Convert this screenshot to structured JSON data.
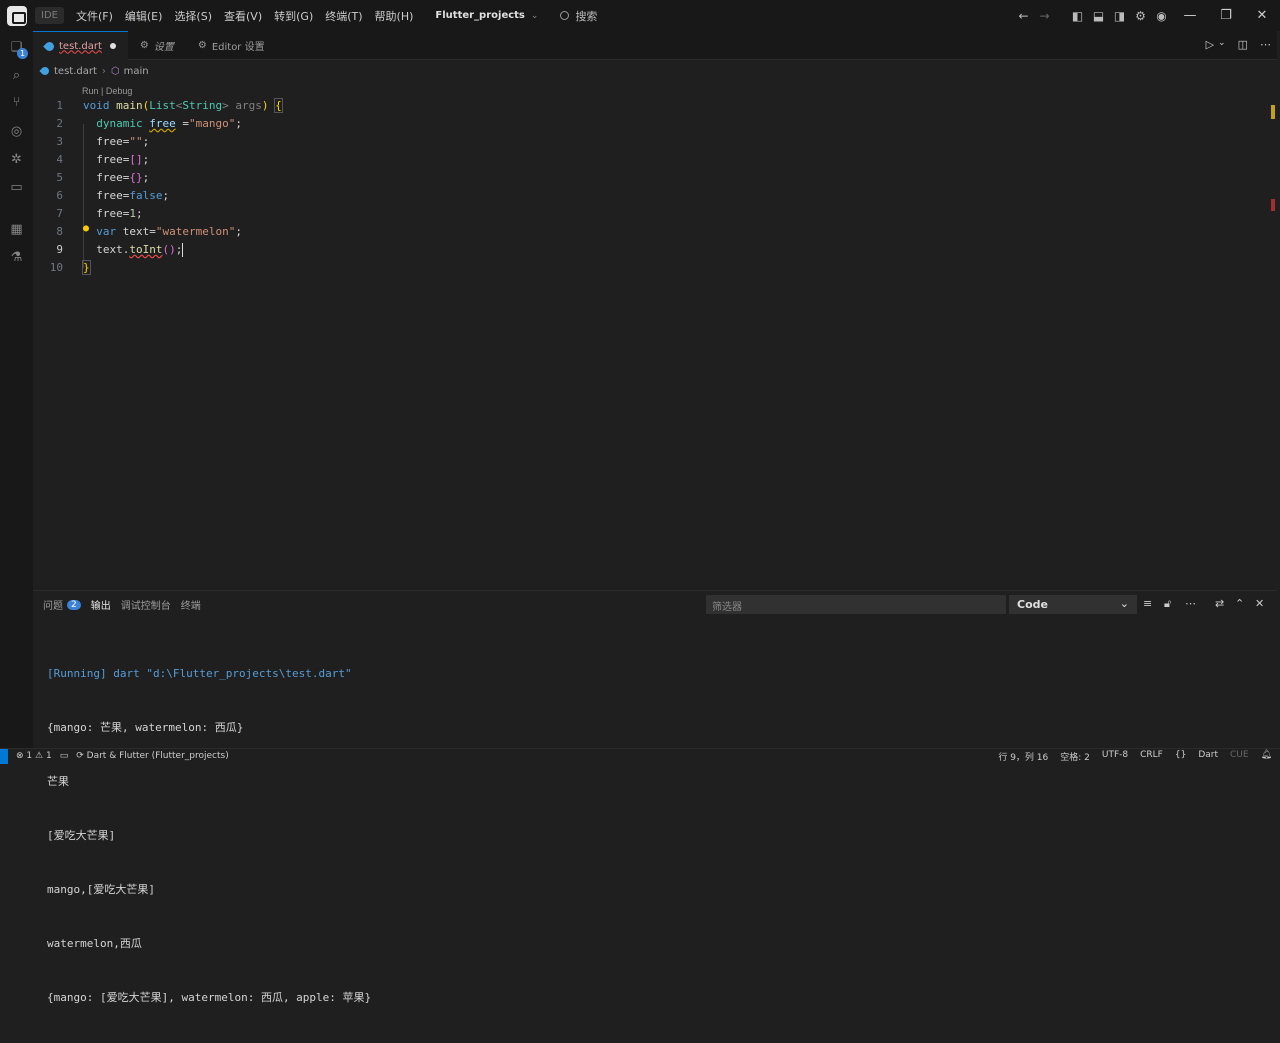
{
  "titlebar": {
    "ide_label": "IDE",
    "menus": [
      "文件(F)",
      "编辑(E)",
      "选择(S)",
      "查看(V)",
      "转到(G)",
      "终端(T)",
      "帮助(H)"
    ],
    "project": "Flutter_projects",
    "search": "搜索"
  },
  "activity": {
    "explorer_badge": "1"
  },
  "tabs": [
    {
      "label": "test.dart",
      "modified": true,
      "active": true
    },
    {
      "label": "设置"
    },
    {
      "label": "Editor 设置"
    }
  ],
  "breadcrumb": {
    "file": "test.dart",
    "symbol": "main"
  },
  "editor": {
    "codelens": "Run | Debug",
    "line_numbers": [
      "1",
      "2",
      "3",
      "4",
      "5",
      "6",
      "7",
      "8",
      "9",
      "10"
    ],
    "current_line": 9
  },
  "panel": {
    "tabs": [
      {
        "label": "问题",
        "count": "2"
      },
      {
        "label": "输出",
        "active": true
      },
      {
        "label": "调试控制台"
      },
      {
        "label": "终端"
      }
    ],
    "filter_placeholder": "筛选器",
    "channel": "Code",
    "output_lines": [
      "[Running] dart \"d:\\Flutter_projects\\test.dart\"",
      "{mango: 芒果, watermelon: 西瓜}",
      "芒果",
      "[爱吃大芒果]",
      "mango,[爱吃大芒果]",
      "watermelon,西瓜",
      "{mango: [爱吃大芒果], watermelon: 西瓜, apple: 苹果}"
    ]
  },
  "statusbar": {
    "errors": "1",
    "warnings": "1",
    "env": "Dart & Flutter (Flutter_projects)",
    "position": "行 9，列 16",
    "spaces": "空格: 2",
    "encoding": "UTF-8",
    "eol": "CRLF",
    "braces": "{}",
    "language": "Dart",
    "cue": "CUE"
  },
  "colors": {
    "accent": "#0078d4",
    "badge": "#3b82d6"
  }
}
